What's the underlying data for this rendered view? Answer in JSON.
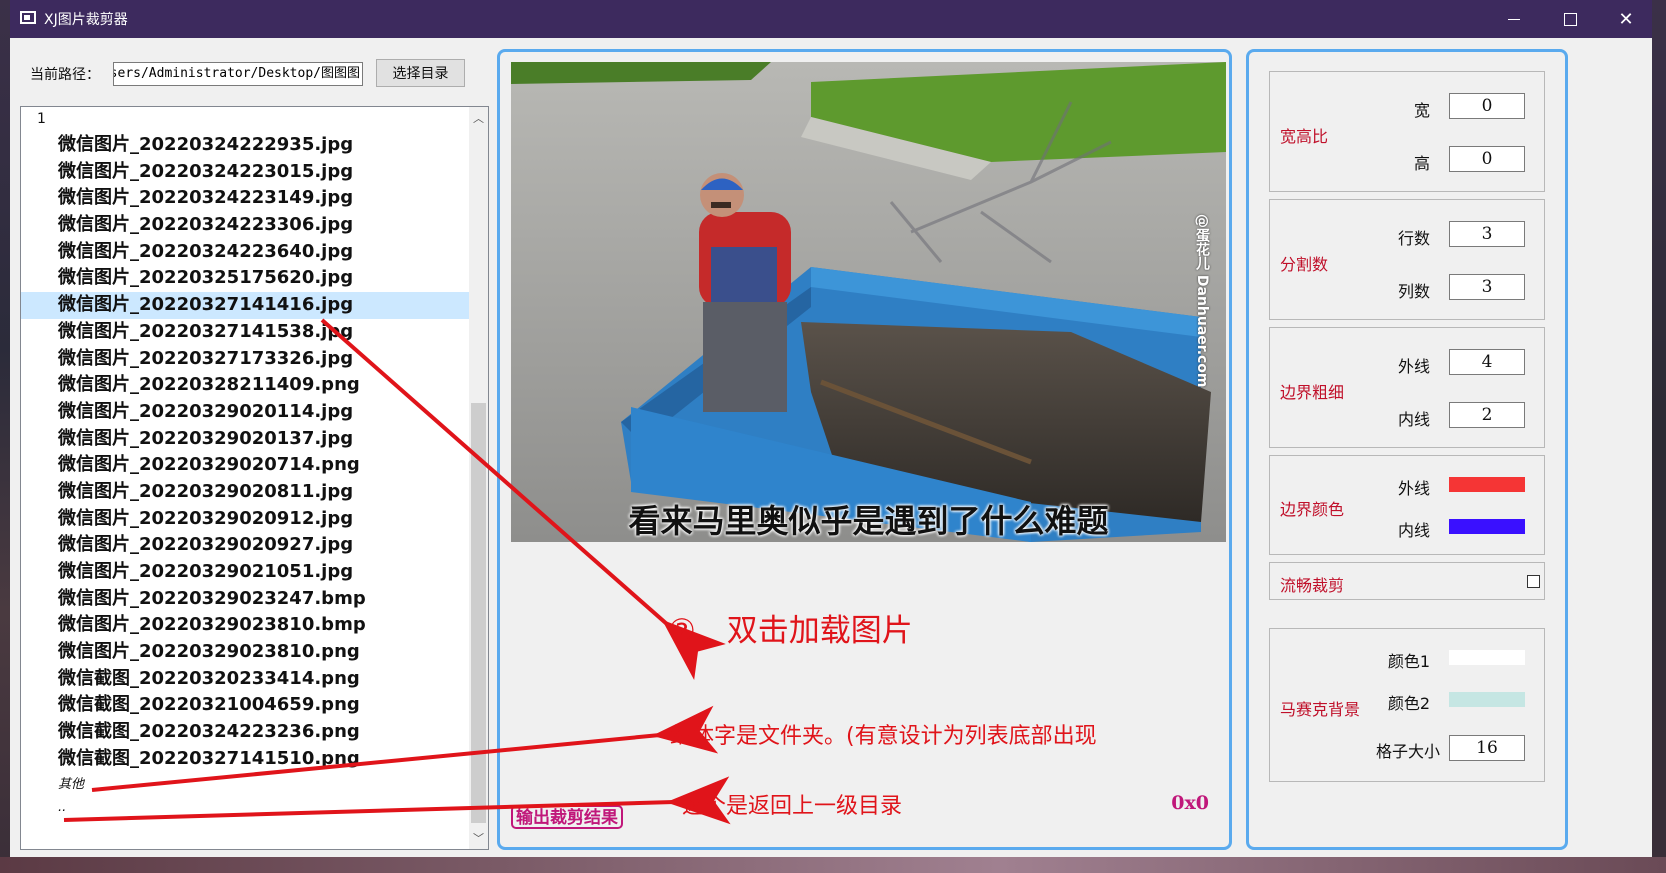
{
  "window": {
    "title": "XJ图片裁剪器"
  },
  "path": {
    "label": "当前路径：",
    "value": "C:/Users/Administrator/Desktop/图图图",
    "choose_button": "选择目录"
  },
  "filelist": {
    "header": "1",
    "files": [
      "微信图片_20220324222935.jpg",
      "微信图片_20220324223015.jpg",
      "微信图片_20220324223149.jpg",
      "微信图片_20220324223306.jpg",
      "微信图片_20220324223640.jpg",
      "微信图片_20220325175620.jpg",
      "微信图片_20220327141416.jpg",
      "微信图片_20220327141538.jpg",
      "微信图片_20220327173326.jpg",
      "微信图片_20220328211409.png",
      "微信图片_20220329020114.jpg",
      "微信图片_20220329020137.jpg",
      "微信图片_20220329020714.png",
      "微信图片_20220329020811.jpg",
      "微信图片_20220329020912.jpg",
      "微信图片_20220329020927.jpg",
      "微信图片_20220329021051.jpg",
      "微信图片_20220329023247.bmp",
      "微信图片_20220329023810.bmp",
      "微信图片_20220329023810.png",
      "微信截图_20220320233414.png",
      "微信截图_20220321004659.png",
      "微信截图_20220324223236.png",
      "微信截图_20220327141510.png"
    ],
    "selected_index": 6,
    "folders": [
      "其他",
      ".."
    ]
  },
  "preview": {
    "caption": "看来马里奥似乎是遇到了什么难题",
    "watermark": "@蛋花儿 Danhuaer.com",
    "output_button": "输出裁剪结果",
    "dimensions": "0x0"
  },
  "settings": {
    "aspect": {
      "title": "宽高比",
      "width_label": "宽",
      "width": "0",
      "height_label": "高",
      "height": "0"
    },
    "split": {
      "title": "分割数",
      "rows_label": "行数",
      "rows": "3",
      "cols_label": "列数",
      "cols": "3"
    },
    "border_width": {
      "title": "边界粗细",
      "outer_label": "外线",
      "outer": "4",
      "inner_label": "内线",
      "inner": "2"
    },
    "border_color": {
      "title": "边界颜色",
      "outer_label": "外线",
      "outer_color": "#f53535",
      "inner_label": "内线",
      "inner_color": "#3a10ff"
    },
    "smooth": {
      "title": "流畅裁剪",
      "checked": false
    },
    "mosaic": {
      "title": "马赛克背景",
      "color1_label": "颜色1",
      "color1": "#ffffff",
      "color2_label": "颜色2",
      "color2": "#c5e6e3",
      "cell_label": "格子大小",
      "cell": "16"
    }
  },
  "annotations": {
    "double_click": "②、双击加载图片",
    "folders_note": "细体字是文件夹。(有意设计为列表底部出现",
    "parent_note": "这个是返回上一级目录"
  },
  "colors": {
    "titlebar": "#3d2a5e",
    "panel_border": "#5aaaee",
    "accent_red": "#c0102a",
    "accent_magenta": "#c0177a",
    "annotation_red": "#e0141a",
    "selection": "#cce8ff"
  }
}
